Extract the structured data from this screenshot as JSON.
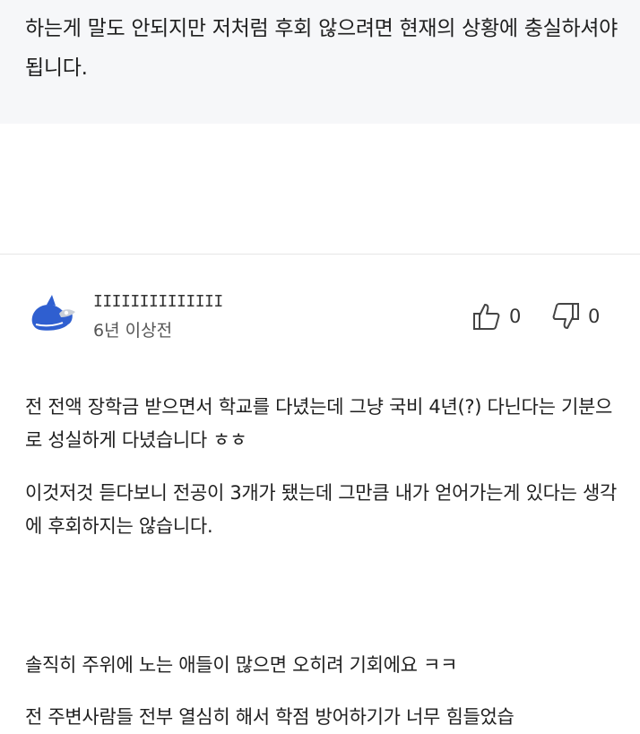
{
  "previous_comment": {
    "text": "하는게 말도 안되지만 저처럼 후회 않으려면 현재의 상황에 충실하셔야 됩니다."
  },
  "comment": {
    "author": "IIIIIIIIIIIIII",
    "time": "6년 이상전",
    "upvotes": "0",
    "downvotes": "0",
    "avatar_icon": "whale-avatar-icon",
    "paragraphs": [
      "전 전액 장학금 받으면서 학교를 다녔는데 그냥 국비 4년(?) 다닌다는 기분으로 성실하게 다녔습니다 ㅎㅎ",
      "이것저것 듣다보니 전공이 3개가 됐는데 그만큼 내가 얻어가는게 있다는 생각에 후회하지는 않습니다.",
      "솔직히 주위에 노는 애들이 많으면 오히려 기회에요 ㅋㅋ",
      "전 주변사람들 전부 열심히 해서 학점 방어하기가 너무 힘들었습"
    ]
  },
  "colors": {
    "accent_blue": "#2f5fd0",
    "top_block_bg": "#f6f7f9"
  }
}
